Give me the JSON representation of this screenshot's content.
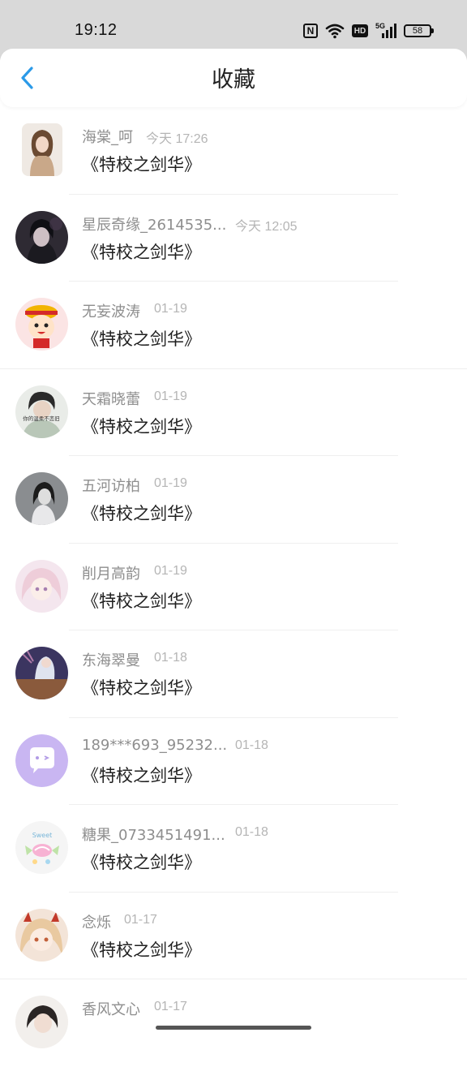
{
  "status": {
    "time": "19:12",
    "nfc": "N",
    "hd": "HD",
    "network": "5G",
    "battery": "58"
  },
  "header": {
    "title": "收藏"
  },
  "items": [
    {
      "name": "海棠_呵",
      "time": "今天 17:26",
      "title": "《特校之剑华》"
    },
    {
      "name": "星辰奇缘_2614535...",
      "time": "今天 12:05",
      "title": "《特校之剑华》"
    },
    {
      "name": "无妄波涛",
      "time": "01-19",
      "title": "《特校之剑华》"
    },
    {
      "name": "天霜晓蕾",
      "time": "01-19",
      "title": "《特校之剑华》",
      "avatar_caption": "你的温柔不恋旧"
    },
    {
      "name": "五河访柏",
      "time": "01-19",
      "title": "《特校之剑华》"
    },
    {
      "name": "削月高韵",
      "time": "01-19",
      "title": "《特校之剑华》"
    },
    {
      "name": "东海翠曼",
      "time": "01-18",
      "title": "《特校之剑华》"
    },
    {
      "name": "189***693_95232...",
      "time": "01-18",
      "title": "《特校之剑华》"
    },
    {
      "name": "糖果_0733451491...",
      "time": "01-18",
      "title": "《特校之剑华》",
      "avatar_caption": "Sweet"
    },
    {
      "name": "念烁",
      "time": "01-17",
      "title": "《特校之剑华》"
    },
    {
      "name": "香风文心",
      "time": "01-17",
      "title": ""
    }
  ],
  "colors": {
    "accent": "#2b9ae8",
    "status_bg": "#d9d9d9",
    "name": "#8e8e8e",
    "time": "#b5b5b5",
    "title": "#1f1f1f"
  }
}
